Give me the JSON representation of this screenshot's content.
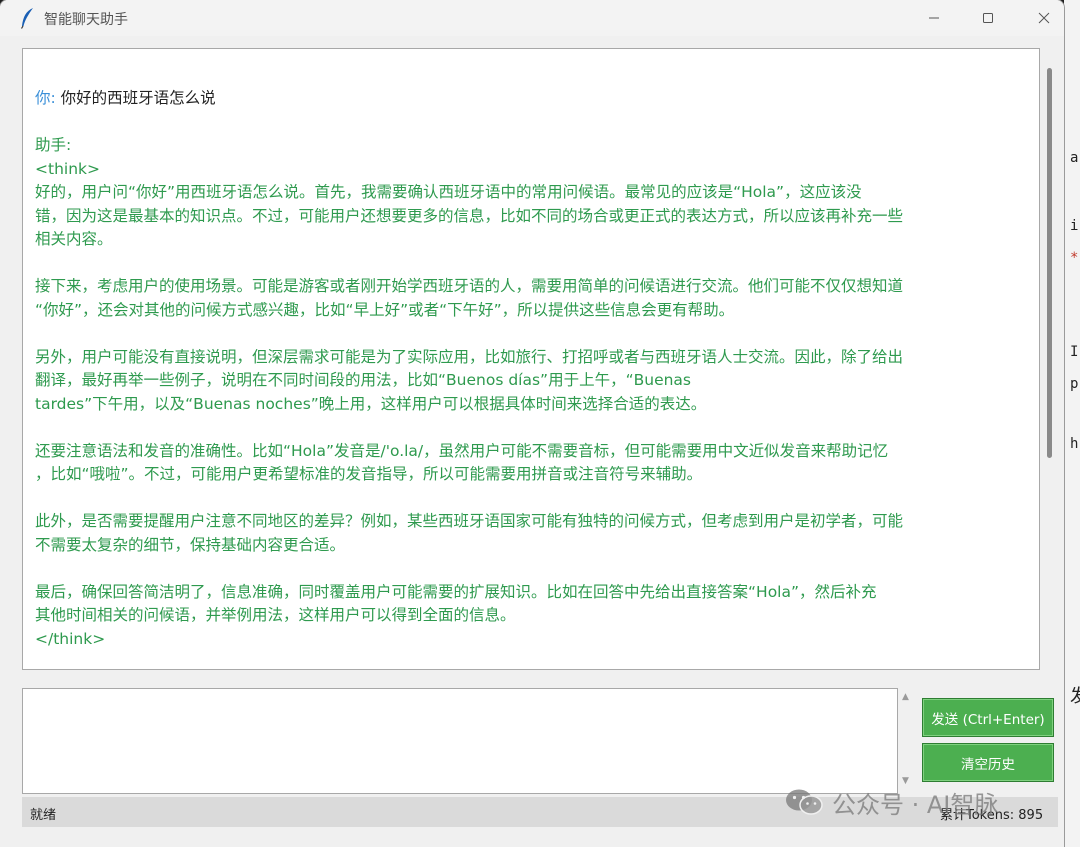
{
  "window": {
    "title": "智能聊天助手"
  },
  "chat": {
    "user_label": "你:",
    "user_message": "你好的西班牙语怎么说",
    "assistant_label": "助手:",
    "assistant_lines": [
      "<think>",
      "好的，用户问“你好”用西班牙语怎么说。首先，我需要确认西班牙语中的常用问候语。最常见的应该是“Hola”，这应该没",
      "错，因为这是最基本的知识点。不过，可能用户还想要更多的信息，比如不同的场合或更正式的表达方式，所以应该再补充一些",
      "相关内容。",
      "",
      "接下来，考虑用户的使用场景。可能是游客或者刚开始学西班牙语的人，需要用简单的问候语进行交流。他们可能不仅仅想知道",
      "“你好”，还会对其他的问候方式感兴趣，比如“早上好”或者“下午好”，所以提供这些信息会更有帮助。",
      "",
      "另外，用户可能没有直接说明，但深层需求可能是为了实际应用，比如旅行、打招呼或者与西班牙语人士交流。因此，除了给出",
      "翻译，最好再举一些例子，说明在不同时间段的用法，比如“Buenos días”用于上午，“Buenas",
      "tardes”下午用，以及“Buenas noches”晚上用，这样用户可以根据具体时间来选择合适的表达。",
      "",
      "还要注意语法和发音的准确性。比如“Hola”发音是/'o.la/，虽然用户可能不需要音标，但可能需要用中文近似发音来帮助记忆",
      "，比如“哦啦”。不过，可能用户更希望标准的发音指导，所以可能需要用拼音或注音符号来辅助。",
      "",
      "此外，是否需要提醒用户注意不同地区的差异？例如，某些西班牙语国家可能有独特的问候方式，但考虑到用户是初学者，可能",
      "不需要太复杂的细节，保持基础内容更合适。",
      "",
      "最后，确保回答简洁明了，信息准确，同时覆盖用户可能需要的扩展知识。比如在回答中先给出直接答案“Hola”，然后补充",
      "其他时间相关的问候语，并举例用法，这样用户可以得到全面的信息。",
      "</think>"
    ]
  },
  "input": {
    "value": ""
  },
  "buttons": {
    "send": "发送 (Ctrl+Enter)",
    "clear": "清空历史"
  },
  "status": {
    "text": "就绪",
    "tokens": "累计Tokens: 895"
  },
  "watermark": {
    "text": "公众号 · AI智脉"
  },
  "background": {
    "fragments": [
      "a",
      "i",
      "*",
      "I",
      "p",
      "h",
      "发"
    ]
  },
  "colors": {
    "assistant_text": "#2e9a4e",
    "user_label": "#3a8fd8",
    "button_bg": "#4caf50"
  }
}
